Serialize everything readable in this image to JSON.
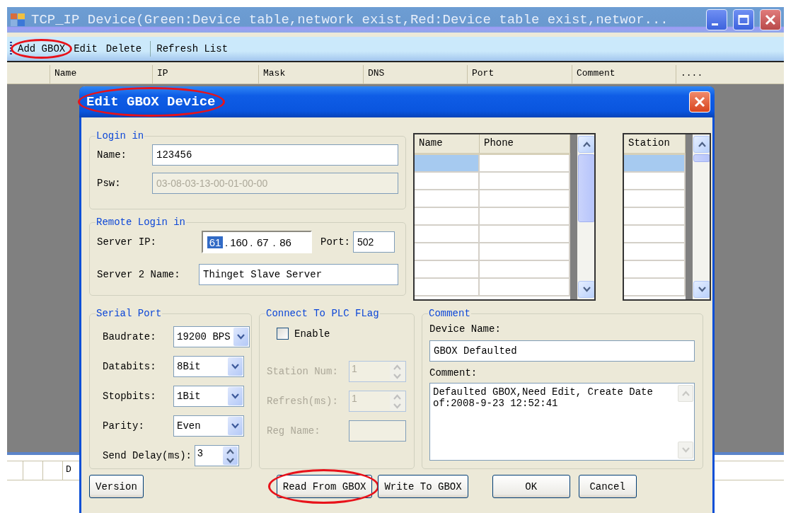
{
  "window": {
    "title": "TCP_IP Device(Green:Device table,network exist,Red:Device table exist,networ..."
  },
  "toolbar": {
    "groups": [
      [
        {
          "label": "Add GBOX",
          "highlighted": true
        },
        {
          "label": "Edit",
          "highlighted": false
        },
        {
          "label": "Delete",
          "highlighted": false
        }
      ],
      [
        {
          "label": "Refresh List",
          "highlighted": false
        }
      ]
    ]
  },
  "grid": {
    "columns": [
      "Name",
      "IP",
      "Mask",
      "DNS",
      "Port",
      "Comment",
      "...."
    ]
  },
  "lower_grid": {
    "columns": [
      "D"
    ]
  },
  "dialog": {
    "title": "Edit GBOX Device",
    "highlighted": true,
    "login": {
      "legend": "Login in",
      "fields": [
        {
          "label": "Name:",
          "value": "123456",
          "disabled": false
        },
        {
          "label": "Psw:",
          "value": "03-08-03-13-00-01-00-00",
          "disabled": true
        }
      ]
    },
    "remote": {
      "legend": "Remote Login in",
      "server_ip": {
        "label": "Server IP:",
        "separator": ".",
        "octets": [
          {
            "text": "61",
            "selected": true
          },
          {
            "text": "160",
            "selected": false
          },
          {
            "text": "67",
            "selected": false
          },
          {
            "text": "86",
            "selected": false
          }
        ]
      },
      "port": {
        "label": "Port:",
        "value": "502"
      },
      "server2": {
        "label": "Server 2 Name:",
        "value": "Thinget Slave Server"
      }
    },
    "phone_table": {
      "columns": [
        "Name",
        "Phone"
      ],
      "rows": [
        {
          "selected": true
        },
        {
          "selected": false
        },
        {
          "selected": false
        },
        {
          "selected": false
        },
        {
          "selected": false
        },
        {
          "selected": false
        },
        {
          "selected": false
        },
        {
          "selected": false
        }
      ]
    },
    "station_table": {
      "columns": [
        "Station"
      ],
      "rows": [
        {
          "selected": true
        },
        {
          "selected": false
        },
        {
          "selected": false
        },
        {
          "selected": false
        },
        {
          "selected": false
        },
        {
          "selected": false
        },
        {
          "selected": false
        },
        {
          "selected": false
        }
      ]
    },
    "serial": {
      "legend": "Serial Port",
      "fields": [
        {
          "kind": "dropdown",
          "label": "Baudrate:",
          "value": "19200 BPS"
        },
        {
          "kind": "dropdown",
          "label": "Databits:",
          "value": "8Bit"
        },
        {
          "kind": "dropdown",
          "label": "Stopbits:",
          "value": "1Bit"
        },
        {
          "kind": "dropdown",
          "label": "Parity:",
          "value": "Even"
        },
        {
          "kind": "spinner",
          "label": "Send Delay(ms):",
          "value": "3"
        }
      ]
    },
    "plc": {
      "legend": "Connect To PLC FLag",
      "enable": {
        "label": "Enable",
        "checked": false
      },
      "fields": [
        {
          "kind": "spinner",
          "label": "Station Num:",
          "value": "1",
          "disabled": true
        },
        {
          "kind": "spinner",
          "label": "Refresh(ms):",
          "value": "1",
          "disabled": true
        },
        {
          "kind": "text",
          "label": "Reg Name:",
          "disabled": true
        }
      ]
    },
    "comment": {
      "legend": "Comment",
      "device_name": {
        "label": "Device Name:",
        "value": "GBOX Defaulted"
      },
      "comment": {
        "label": "Comment:",
        "value": "Defaulted GBOX,Need Edit, Create Date of:2008-9-23 12:52:41"
      }
    },
    "buttons": {
      "left": [
        {
          "label": "Version",
          "highlighted": false
        }
      ],
      "right": [
        {
          "label": "Read From GBOX",
          "highlighted": true
        },
        {
          "label": "Write To GBOX",
          "highlighted": false
        },
        {
          "label": "OK",
          "highlighted": false
        },
        {
          "label": "Cancel",
          "highlighted": false
        }
      ]
    }
  }
}
